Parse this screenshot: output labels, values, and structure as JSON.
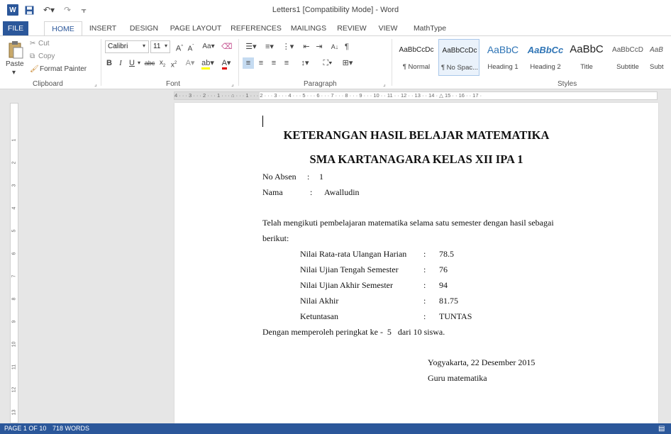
{
  "title_bar": {
    "title": "Letters1 [Compatibility Mode] - Word",
    "app_icon_letter": "W"
  },
  "tabs": [
    "FILE",
    "HOME",
    "INSERT",
    "DESIGN",
    "PAGE LAYOUT",
    "REFERENCES",
    "MAILINGS",
    "REVIEW",
    "VIEW",
    "MathType"
  ],
  "active_tab": "HOME",
  "ribbon": {
    "clipboard": {
      "paste": "Paste",
      "cut": "Cut",
      "copy": "Copy",
      "format_painter": "Format Painter",
      "label": "Clipboard"
    },
    "font": {
      "name": "Calibri",
      "size": "11",
      "label": "Font"
    },
    "paragraph": {
      "label": "Paragraph"
    },
    "styles": {
      "label": "Styles",
      "items": [
        {
          "sample": "AaBbCcDc",
          "name": "¶ Normal"
        },
        {
          "sample": "AaBbCcDc",
          "name": "¶ No Spac..."
        },
        {
          "sample": "AaBbC",
          "name": "Heading 1"
        },
        {
          "sample": "AaBbCc",
          "name": "Heading 2"
        },
        {
          "sample": "AaBbC",
          "name": "Title"
        },
        {
          "sample": "AaBbCcD",
          "name": "Subtitle"
        },
        {
          "sample": "AaB",
          "name": "Subt"
        }
      ],
      "selected_index": 1
    }
  },
  "document": {
    "heading1": "KETERANGAN HASIL BELAJAR MATEMATIKA",
    "heading2": "SMA KARTANAGARA KELAS XII IPA 1",
    "no_absen_label": "No Absen",
    "no_absen_value": "1",
    "nama_label": "Nama",
    "nama_value": "Awalludin",
    "intro_line1": "Telah mengikuti pembelajaran matematika selama satu semester dengan hasil sebagai",
    "intro_line2": "berikut:",
    "scores": [
      {
        "label": "Nilai Rata-rata Ulangan Harian",
        "value": "78.5"
      },
      {
        "label": "Nilai Ujian Tengah Semester",
        "value": "76"
      },
      {
        "label": "Nilai Ujian Akhir Semester",
        "value": "94"
      },
      {
        "label": "Nilai Akhir",
        "value": "81.75"
      },
      {
        "label": "Ketuntasan",
        "value": "TUNTAS"
      }
    ],
    "rank_line": "Dengan memperoleh peringkat ke -  5   dari 10 siswa.",
    "place_date": "Yogyakarta, 22 Desember 2015",
    "signer": "Guru matematika"
  },
  "status_bar": {
    "page": "PAGE 1 OF 10",
    "words": "718 WORDS"
  },
  "colors": {
    "accent": "#2b579a"
  }
}
